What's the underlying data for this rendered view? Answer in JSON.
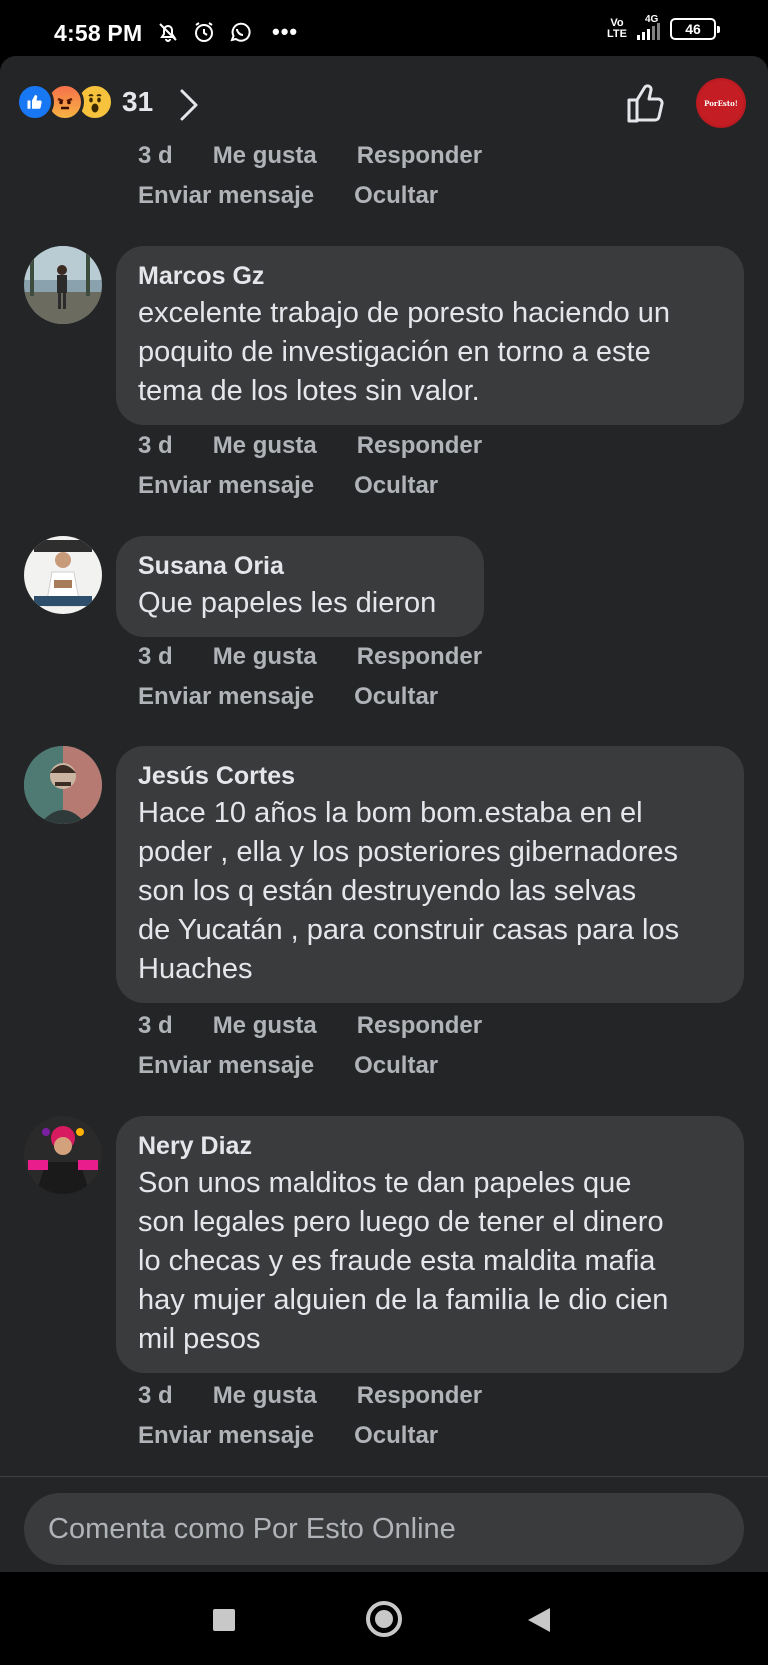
{
  "status_bar": {
    "time": "4:58 PM",
    "network_top": "Vo",
    "network_bottom": "LTE",
    "signal_label": "4G",
    "battery": "46",
    "more": "•••"
  },
  "reactions": {
    "count": "31",
    "types": [
      "like-icon",
      "angry-icon",
      "wow-icon"
    ]
  },
  "actions": {
    "time": "3 d",
    "like": "Me gusta",
    "reply": "Responder",
    "message": "Enviar mensaje",
    "hide": "Ocultar"
  },
  "comments": [
    {
      "author": "Marcos Gz",
      "lines": [
        "excelente trabajo de poresto haciendo un",
        "poquito de investigación en torno a este",
        "tema de los lotes sin valor."
      ]
    },
    {
      "author": "Susana Oria",
      "lines": [
        "Que papeles les dieron"
      ]
    },
    {
      "author": "Jesús Cortes",
      "lines": [
        "Hace 10 años la bom bom.estaba en el",
        "poder , ella y los posteriores gibernadores",
        "son  los q están destruyendo las selvas",
        "de Yucatán , para construir casas para los",
        "Huaches"
      ]
    },
    {
      "author": "Nery Diaz",
      "lines": [
        "Son unos malditos te dan papeles que",
        "son legales pero luego de tener el dinero",
        "lo checas y es fraude esta maldita mafia",
        "hay mujer alguien de la familia le dio cien",
        "mil pesos"
      ]
    }
  ],
  "composer": {
    "placeholder": "Comenta como Por Esto Online"
  },
  "page_avatar_text": "PorEsto!",
  "colors": {
    "background": "#242526",
    "bubble": "#3a3b3c",
    "text": "#e4e6eb",
    "muted": "#b0b3b8",
    "like": "#1877f2"
  }
}
